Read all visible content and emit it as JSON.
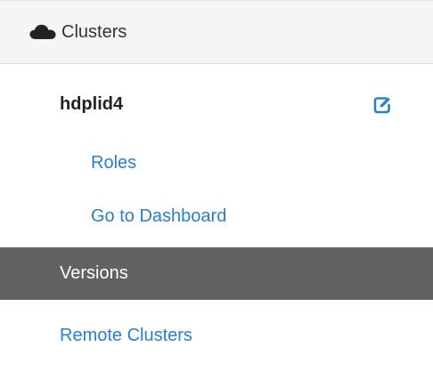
{
  "header": {
    "icon": "cloud-icon",
    "title": "Clusters"
  },
  "cluster": {
    "name": "hdplid4",
    "edit_icon": "edit-icon",
    "links": [
      {
        "label": "Roles"
      },
      {
        "label": "Go to Dashboard"
      }
    ]
  },
  "nav": {
    "versions_label": "Versions",
    "remote_clusters_label": "Remote Clusters"
  },
  "colors": {
    "link": "#2a7fc9",
    "active_bg": "#626262",
    "header_bg": "#f5f5f5"
  }
}
